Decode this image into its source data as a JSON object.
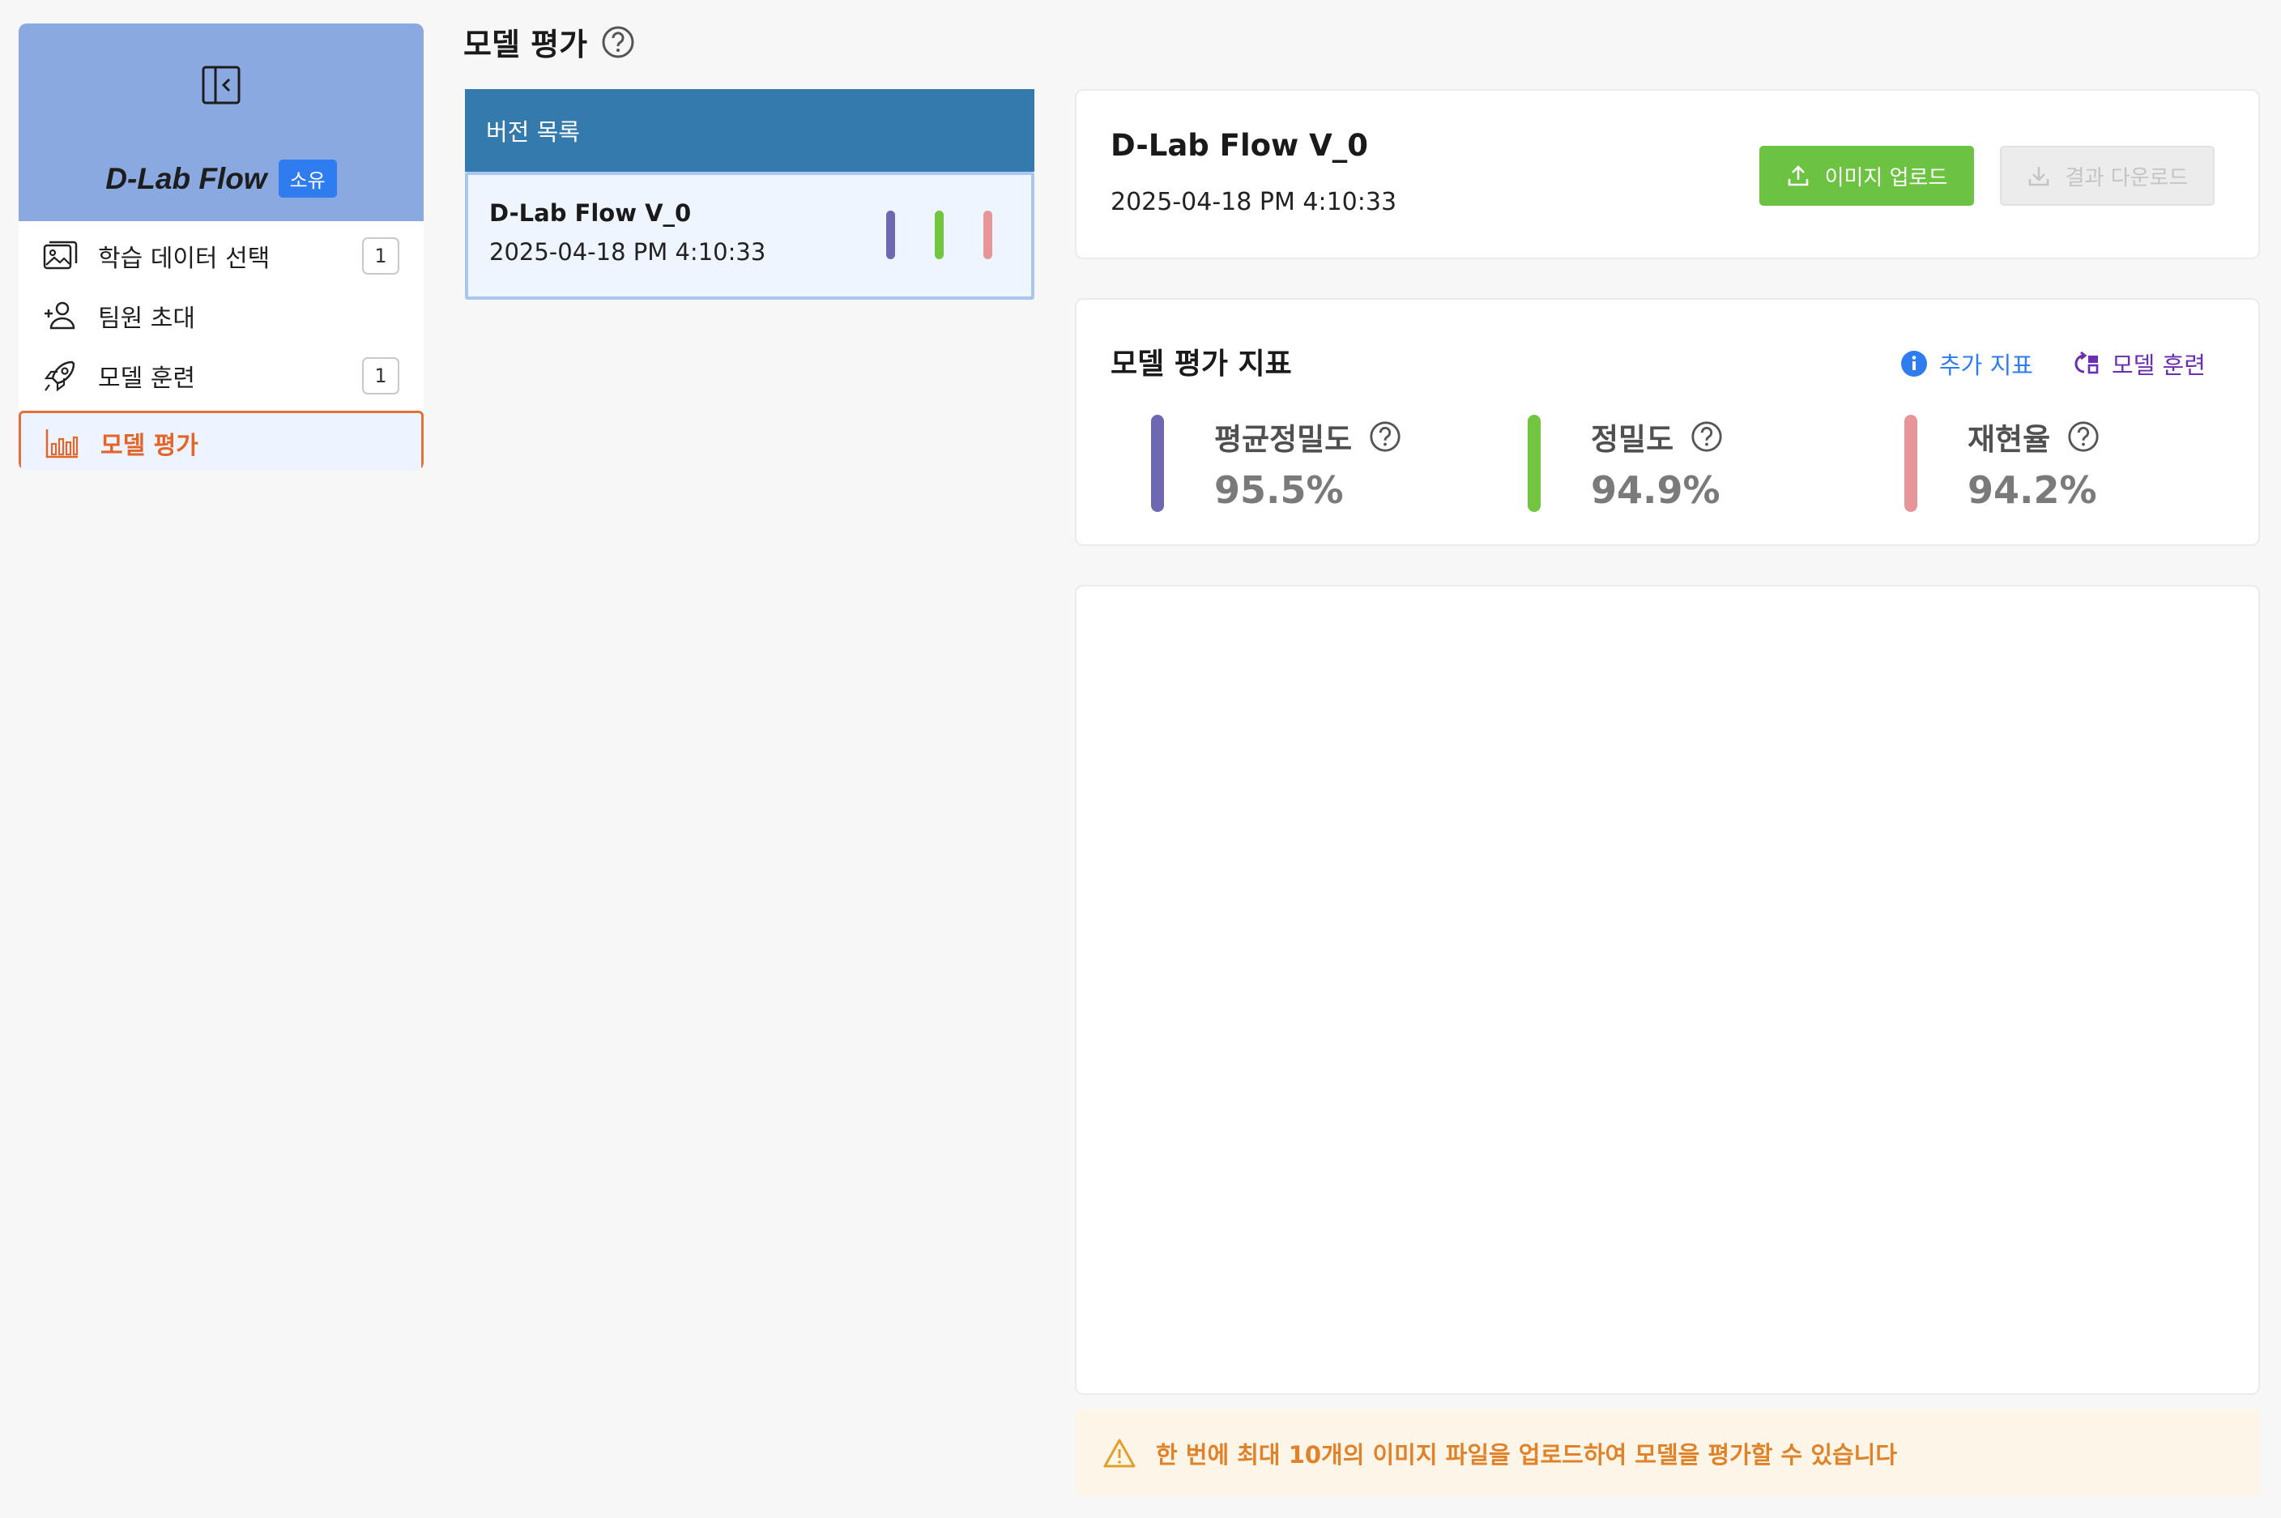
{
  "sidebar": {
    "brand_title": "D-Lab Flow",
    "brand_badge": "소유",
    "items": [
      {
        "label": "학습 데이터 선택",
        "count": "1",
        "icon": "image-gallery-icon"
      },
      {
        "label": "팀원 초대",
        "icon": "user-plus-icon"
      },
      {
        "label": "모델 훈련",
        "count": "1",
        "icon": "rocket-icon"
      },
      {
        "label": "모델 평가",
        "icon": "bar-chart-icon",
        "active": true
      }
    ]
  },
  "page": {
    "title": "모델 평가"
  },
  "versions": {
    "header": "버전 목록",
    "items": [
      {
        "name": "D-Lab Flow V_0",
        "date": "2025-04-18 PM 4:10:33"
      }
    ]
  },
  "detail": {
    "name": "D-Lab Flow V_0",
    "date": "2025-04-18 PM 4:10:33",
    "upload_label": "이미지 업로드",
    "download_label": "결과 다운로드"
  },
  "metrics": {
    "title": "모델 평가 지표",
    "extra_link": "추가 지표",
    "train_link": "모델 훈련",
    "items": [
      {
        "label": "평균정밀도",
        "value": "95.5%",
        "color": "#6e68b3"
      },
      {
        "label": "정밀도",
        "value": "94.9%",
        "color": "#72c53e"
      },
      {
        "label": "재현율",
        "value": "94.2%",
        "color": "#e8959a"
      }
    ]
  },
  "notice": {
    "text": "한 번에 최대 10개의 이미지 파일을 업로드하여 모델을 평가할 수 있습니다"
  },
  "colors": {
    "accent": "#357aad",
    "active": "#e2652a",
    "upload": "#6cc241",
    "link": "#2f7cf0",
    "train": "#6a2fb0"
  }
}
